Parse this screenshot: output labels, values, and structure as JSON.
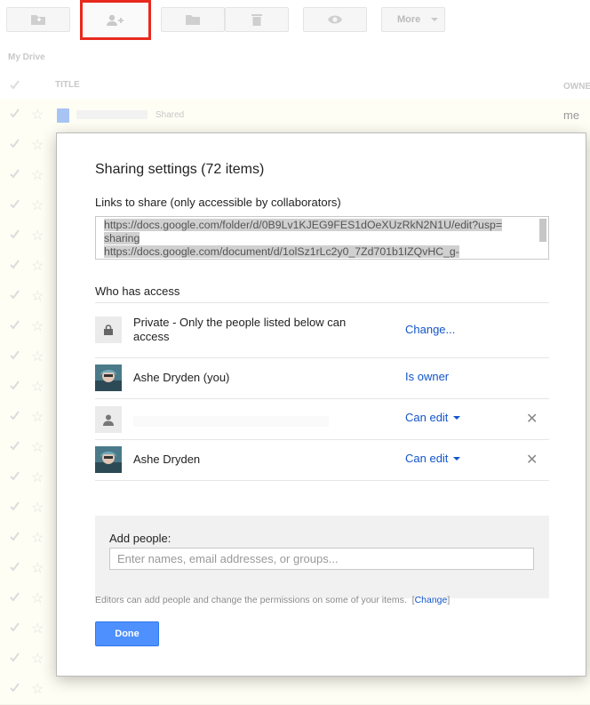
{
  "toolbar": {
    "more_label": "More"
  },
  "drive": {
    "breadcrumb": "My Drive",
    "columns": {
      "title": "TITLE",
      "owner": "OWNE"
    },
    "first_row": {
      "shared_label": "Shared",
      "owner": "me"
    }
  },
  "dialog": {
    "title": "Sharing settings (72 items)",
    "links_label": "Links to share (only accessible by collaborators)",
    "links_text": "https://docs.google.com/folder/d/0B9Lv1KJEG9FES1dOeXUzRkN2N1U/edit?usp=sharing\nhttps://docs.google.com/document/d/1olSz1rLc2y0_7Zd701b1IZQvHC_g-",
    "who_has_access": "Who has access",
    "access": [
      {
        "icon": "lock-icon",
        "name": "Private - Only the people listed below can access",
        "role": "Change..."
      },
      {
        "icon": "avatar",
        "name": "Ashe Dryden (you)",
        "role": "Is owner"
      },
      {
        "icon": "person-icon",
        "name": "",
        "role": "Can edit"
      },
      {
        "icon": "avatar",
        "name": "Ashe Dryden",
        "role": "Can edit"
      }
    ],
    "add_people_label": "Add people:",
    "add_people_placeholder": "Enter names, email addresses, or groups...",
    "editors_note": "Editors can add people and change the permissions on some of your items.",
    "editors_change_link": "Change",
    "done_label": "Done"
  },
  "colors": {
    "link": "#1155cc",
    "done_button": "#4d90fe",
    "highlight_border": "#e8291e"
  }
}
